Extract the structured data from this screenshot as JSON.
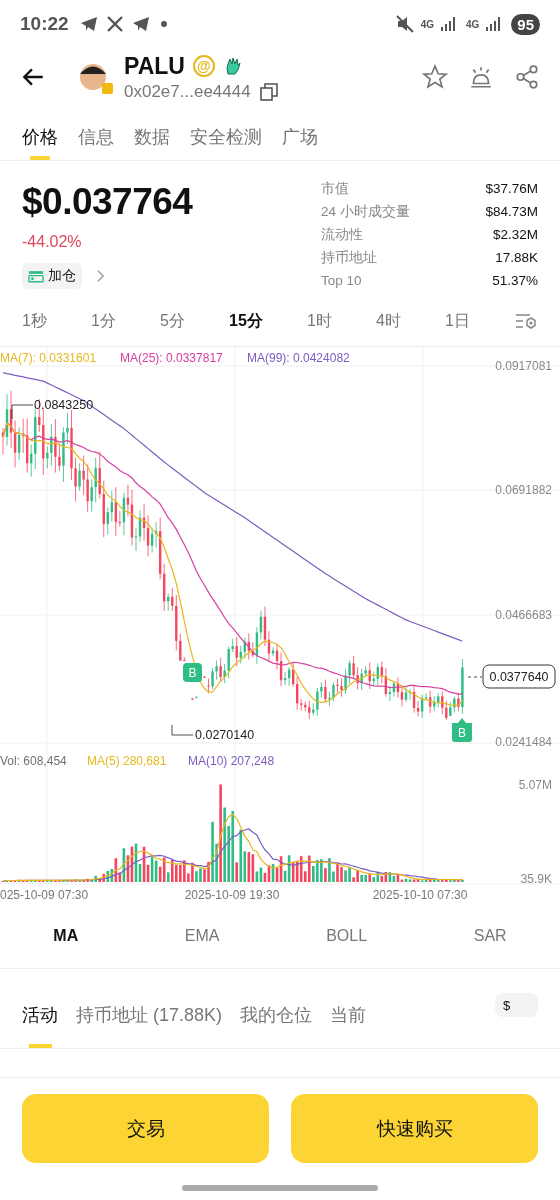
{
  "status_bar": {
    "time": "10:22",
    "network": [
      "4G",
      "4G"
    ],
    "battery": "95"
  },
  "header": {
    "title": "PALU",
    "badge": "@",
    "address": "0x02e7...ee4444"
  },
  "tabs": [
    {
      "label": "价格",
      "selected": true
    },
    {
      "label": "信息",
      "selected": false
    },
    {
      "label": "数据",
      "selected": false
    },
    {
      "label": "安全检测",
      "selected": false
    },
    {
      "label": "广场",
      "selected": false
    }
  ],
  "price": {
    "value": "$0.037764",
    "change": "-44.02%"
  },
  "add_position": {
    "label": "加仓"
  },
  "stats": [
    {
      "label": "市值",
      "value": "$37.76M"
    },
    {
      "label": "24 小时成交量",
      "value": "$84.73M"
    },
    {
      "label": "流动性",
      "value": "$2.32M"
    },
    {
      "label": "持币地址",
      "value": "17.88K"
    },
    {
      "label": "Top 10",
      "value": "51.37%"
    }
  ],
  "timeframes": [
    {
      "label": "1秒",
      "selected": false
    },
    {
      "label": "1分",
      "selected": false
    },
    {
      "label": "5分",
      "selected": false
    },
    {
      "label": "15分",
      "selected": true
    },
    {
      "label": "1时",
      "selected": false
    },
    {
      "label": "4时",
      "selected": false
    },
    {
      "label": "1日",
      "selected": false
    }
  ],
  "chart": {
    "ma_legend": [
      {
        "label": "MA(7): 0.0331601",
        "color": "#e6b81e"
      },
      {
        "label": "MA(25): 0.0337817",
        "color": "#d6409f"
      },
      {
        "label": "MA(99): 0.0424082",
        "color": "#7d5cc0"
      }
    ],
    "price_axis": [
      "0.0917081",
      "0.0691882",
      "0.0466683",
      "0.0241484"
    ],
    "high_marker": "0.0843250",
    "low_marker": "0.0270140",
    "last_price": "0.0377640",
    "buy_markers": [
      "B",
      "B"
    ],
    "volume_legend": [
      {
        "label": "Vol: 608,454",
        "color": "#707070"
      },
      {
        "label": "MA(5) 280,681",
        "color": "#e6b81e"
      },
      {
        "label": "MA(10) 207,248",
        "color": "#7d5cc0"
      }
    ],
    "volume_axis": [
      "5.07M",
      "35.9K"
    ],
    "date_labels": [
      "025-10-09 07:30",
      "2025-10-09 19:30",
      "2025-10-10 07:30"
    ]
  },
  "indicators": [
    {
      "label": "MA",
      "selected": true
    },
    {
      "label": "EMA",
      "selected": false
    },
    {
      "label": "BOLL",
      "selected": false
    },
    {
      "label": "SAR",
      "selected": false
    }
  ],
  "bottom_tabs": [
    {
      "label": "活动",
      "selected": true
    },
    {
      "label": "持币地址 (17.88K)",
      "selected": false
    },
    {
      "label": "我的仓位",
      "selected": false
    },
    {
      "label": "当前",
      "selected": false
    }
  ],
  "currency_toggle": "$",
  "actions": [
    "交易",
    "快速购买"
  ]
}
